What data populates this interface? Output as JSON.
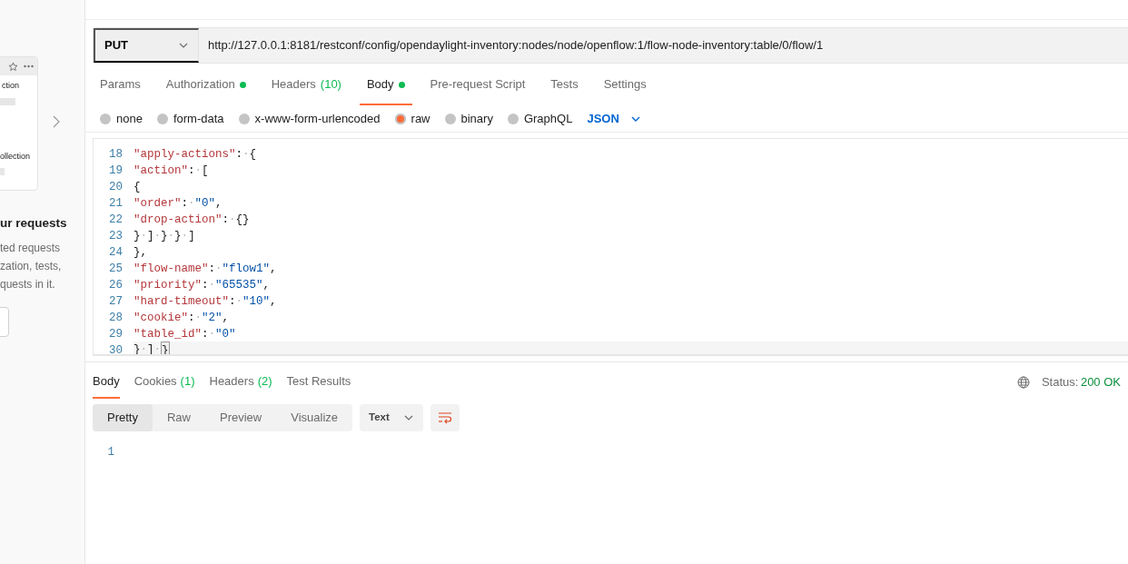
{
  "sidebar": {
    "card": {
      "line_1": "ction",
      "line_2": "ollection"
    },
    "heading": "ur requests",
    "paragraph": [
      "ted requests",
      "zation, tests,",
      "quests in it."
    ]
  },
  "request": {
    "method": "PUT",
    "url": "http://127.0.0.1:8181/restconf/config/opendaylight-inventory:nodes/node/openflow:1/flow-node-inventory:table/0/flow/1"
  },
  "tabs": [
    {
      "label": "Params",
      "selected": false
    },
    {
      "label": "Authorization",
      "selected": false,
      "dot": true
    },
    {
      "label": "Headers",
      "count": "(10)",
      "selected": false
    },
    {
      "label": "Body",
      "selected": true,
      "dot": true
    },
    {
      "label": "Pre-request Script",
      "selected": false
    },
    {
      "label": "Tests",
      "selected": false
    },
    {
      "label": "Settings",
      "selected": false
    }
  ],
  "body_types": [
    {
      "label": "none",
      "selected": false
    },
    {
      "label": "form-data",
      "selected": false
    },
    {
      "label": "x-www-form-urlencoded",
      "selected": false
    },
    {
      "label": "raw",
      "selected": true
    },
    {
      "label": "binary",
      "selected": false
    },
    {
      "label": "GraphQL",
      "selected": false
    }
  ],
  "format": "JSON",
  "editor": {
    "lines": [
      {
        "number": "18",
        "tokens": [
          {
            "kind": "key",
            "text": "\"apply-actions\""
          },
          {
            "kind": "punct",
            "text": ":"
          },
          {
            "kind": "space",
            "text": "·"
          },
          {
            "kind": "punct",
            "text": "{"
          }
        ]
      },
      {
        "number": "19",
        "tokens": [
          {
            "kind": "key",
            "text": "\"action\""
          },
          {
            "kind": "punct",
            "text": ":"
          },
          {
            "kind": "space",
            "text": "·"
          },
          {
            "kind": "punct",
            "text": "["
          }
        ]
      },
      {
        "number": "20",
        "tokens": [
          {
            "kind": "punct",
            "text": "{"
          }
        ]
      },
      {
        "number": "21",
        "tokens": [
          {
            "kind": "key",
            "text": "\"order\""
          },
          {
            "kind": "punct",
            "text": ":"
          },
          {
            "kind": "space",
            "text": "·"
          },
          {
            "kind": "string",
            "text": "\"0\""
          },
          {
            "kind": "punct",
            "text": ","
          }
        ]
      },
      {
        "number": "22",
        "tokens": [
          {
            "kind": "key",
            "text": "\"drop-action\""
          },
          {
            "kind": "punct",
            "text": ":"
          },
          {
            "kind": "space",
            "text": "·"
          },
          {
            "kind": "punct",
            "text": "{}"
          }
        ]
      },
      {
        "number": "23",
        "tokens": [
          {
            "kind": "punct",
            "text": "}"
          },
          {
            "kind": "space",
            "text": "·"
          },
          {
            "kind": "punct",
            "text": "]"
          },
          {
            "kind": "space",
            "text": "·"
          },
          {
            "kind": "punct",
            "text": "}"
          },
          {
            "kind": "space",
            "text": "·"
          },
          {
            "kind": "punct",
            "text": "}"
          },
          {
            "kind": "space",
            "text": "·"
          },
          {
            "kind": "punct",
            "text": "]"
          }
        ]
      },
      {
        "number": "24",
        "tokens": [
          {
            "kind": "punct",
            "text": "},"
          }
        ]
      },
      {
        "number": "25",
        "tokens": [
          {
            "kind": "key",
            "text": "\"flow-name\""
          },
          {
            "kind": "punct",
            "text": ":"
          },
          {
            "kind": "space",
            "text": "·"
          },
          {
            "kind": "string",
            "text": "\"flow1\""
          },
          {
            "kind": "punct",
            "text": ","
          }
        ]
      },
      {
        "number": "26",
        "tokens": [
          {
            "kind": "key",
            "text": "\"priority\""
          },
          {
            "kind": "punct",
            "text": ":"
          },
          {
            "kind": "space",
            "text": "·"
          },
          {
            "kind": "string",
            "text": "\"65535\""
          },
          {
            "kind": "punct",
            "text": ","
          }
        ]
      },
      {
        "number": "27",
        "tokens": [
          {
            "kind": "key",
            "text": "\"hard-timeout\""
          },
          {
            "kind": "punct",
            "text": ":"
          },
          {
            "kind": "space",
            "text": "·"
          },
          {
            "kind": "string",
            "text": "\"10\""
          },
          {
            "kind": "punct",
            "text": ","
          }
        ]
      },
      {
        "number": "28",
        "tokens": [
          {
            "kind": "key",
            "text": "\"cookie\""
          },
          {
            "kind": "punct",
            "text": ":"
          },
          {
            "kind": "space",
            "text": "·"
          },
          {
            "kind": "string",
            "text": "\"2\""
          },
          {
            "kind": "punct",
            "text": ","
          }
        ]
      },
      {
        "number": "29",
        "tokens": [
          {
            "kind": "key",
            "text": "\"table_id\""
          },
          {
            "kind": "punct",
            "text": ":"
          },
          {
            "kind": "space",
            "text": "·"
          },
          {
            "kind": "string",
            "text": "\"0\""
          }
        ]
      },
      {
        "number": "30",
        "current": true,
        "tokens": [
          {
            "kind": "punct",
            "text": "}"
          },
          {
            "kind": "space",
            "text": "·"
          },
          {
            "kind": "punct",
            "text": "]"
          },
          {
            "kind": "space",
            "text": "·"
          },
          {
            "kind": "match",
            "text": "}"
          }
        ]
      }
    ]
  },
  "response": {
    "tabs": [
      {
        "label": "Body",
        "selected": true
      },
      {
        "label": "Cookies",
        "count": "(1)",
        "selected": false
      },
      {
        "label": "Headers",
        "count": "(2)",
        "selected": false
      },
      {
        "label": "Test Results",
        "selected": false
      }
    ],
    "status_label": "Status:",
    "status": "200 OK",
    "views": [
      {
        "label": "Pretty",
        "selected": true
      },
      {
        "label": "Raw",
        "selected": false
      },
      {
        "label": "Preview",
        "selected": false
      },
      {
        "label": "Visualize",
        "selected": false
      }
    ],
    "type": "Text",
    "lines": [
      "1"
    ]
  }
}
